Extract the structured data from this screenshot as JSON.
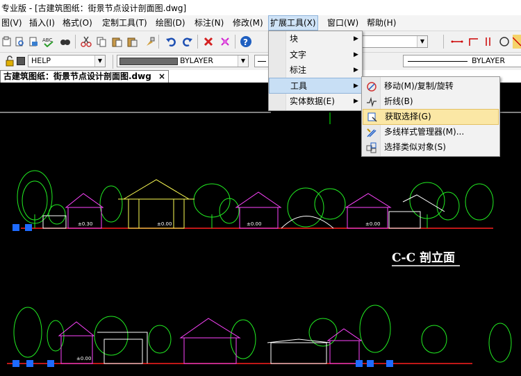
{
  "title_bar": {
    "text": "专业版  - [古建筑图纸：街景节点设计剖面图.dwg]"
  },
  "menubar": {
    "items": [
      {
        "label": "图(V)"
      },
      {
        "label": "插入(I)"
      },
      {
        "label": "格式(O)"
      },
      {
        "label": "定制工具(T)"
      },
      {
        "label": "绘图(D)"
      },
      {
        "label": "标注(N)"
      },
      {
        "label": "修改(M)"
      },
      {
        "label": "扩展工具(X)"
      },
      {
        "label": "窗口(W)"
      },
      {
        "label": "帮助(H)"
      }
    ]
  },
  "toolbar2": {
    "layer_name": "HELP",
    "linetype": "BYLAYER",
    "lineweight": "BYLAYER"
  },
  "doc_tab": {
    "label": "古建筑图纸：街景节点设计剖面图.dwg",
    "close": "×"
  },
  "ext_menu": {
    "items": [
      {
        "label": "块"
      },
      {
        "label": "文字"
      },
      {
        "label": "标注"
      },
      {
        "label": "工具"
      },
      {
        "label": "实体数据(E)"
      }
    ]
  },
  "tools_submenu": {
    "items": [
      {
        "label": "移动(M)/复制/旋转",
        "icon": "move-copy-rotate-icon"
      },
      {
        "label": "折线(B)",
        "icon": "break-line-icon"
      },
      {
        "label": "获取选择(G)",
        "icon": "get-selection-icon"
      },
      {
        "label": "多线样式管理器(M)...",
        "icon": "multiline-style-icon"
      },
      {
        "label": "选择类似对象(S)",
        "icon": "select-similar-icon"
      }
    ]
  },
  "drawing": {
    "section_title": "C-C 剖立面",
    "labels": [
      "±0.30",
      "±0.00",
      "±0.00",
      "±0.00",
      "±0.00"
    ]
  },
  "colors": {
    "accent_highlight": "#fbe7a5",
    "menu_active": "#c8dff5",
    "canvas": "#000000"
  }
}
